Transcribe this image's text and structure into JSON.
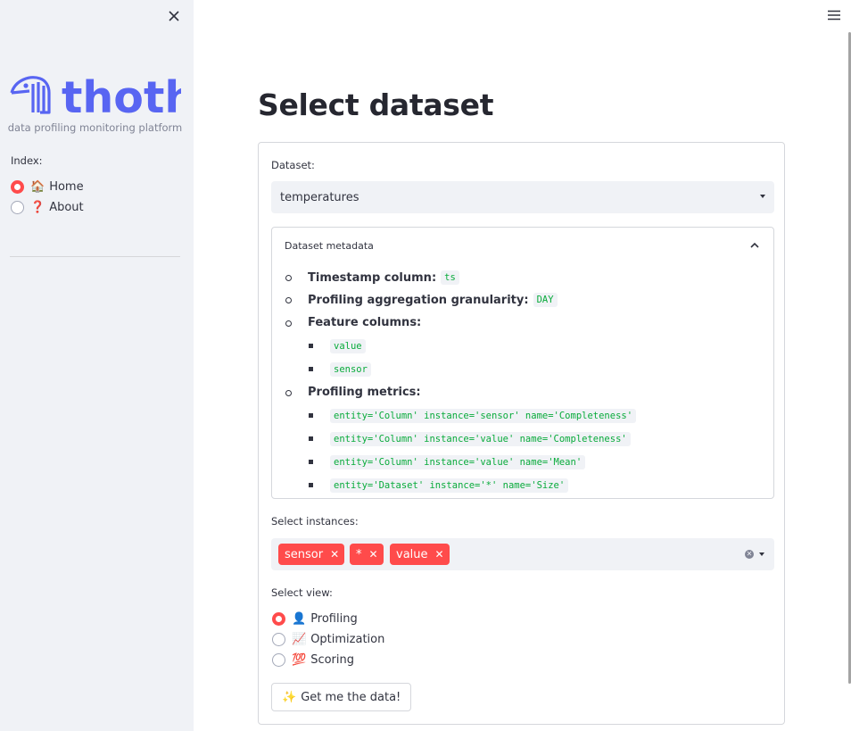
{
  "sidebar": {
    "logo_text": "thoth",
    "logo_subtitle": "data profiling monitoring platform",
    "index_label": "Index:",
    "items": [
      {
        "emoji": "🏠",
        "label": "Home",
        "selected": true
      },
      {
        "emoji": "❓",
        "label": "About",
        "selected": false
      }
    ]
  },
  "main": {
    "title": "Select dataset",
    "dataset": {
      "label": "Dataset:",
      "value": "temperatures"
    },
    "metadata": {
      "title": "Dataset metadata",
      "timestamp_label": "Timestamp column:",
      "timestamp_value": "ts",
      "granularity_label": "Profiling aggregation granularity:",
      "granularity_value": "DAY",
      "features_label": "Feature columns:",
      "features": [
        "value",
        "sensor"
      ],
      "metrics_label": "Profiling metrics:",
      "metrics": [
        "entity='Column' instance='sensor' name='Completeness'",
        "entity='Column' instance='value' name='Completeness'",
        "entity='Column' instance='value' name='Mean'",
        "entity='Dataset' instance='*' name='Size'"
      ]
    },
    "instances": {
      "label": "Select instances:",
      "selected": [
        "sensor",
        "*",
        "value"
      ]
    },
    "view": {
      "label": "Select view:",
      "options": [
        {
          "emoji": "👤",
          "label": "Profiling",
          "selected": true
        },
        {
          "emoji": "📈",
          "label": "Optimization",
          "selected": false
        },
        {
          "emoji": "💯",
          "label": "Scoring",
          "selected": false
        }
      ]
    },
    "submit": {
      "emoji": "✨",
      "label": "Get me the data!"
    }
  },
  "colors": {
    "accent": "#ff4b4b",
    "sidebar_bg": "#f0f2f6",
    "logo": "#5865f2",
    "code_text": "#09ab3b"
  },
  "icons": [
    "close-icon",
    "hamburger-icon",
    "chevron-up-icon",
    "caret-down-icon",
    "clear-icon",
    "remove-chip-icon"
  ]
}
